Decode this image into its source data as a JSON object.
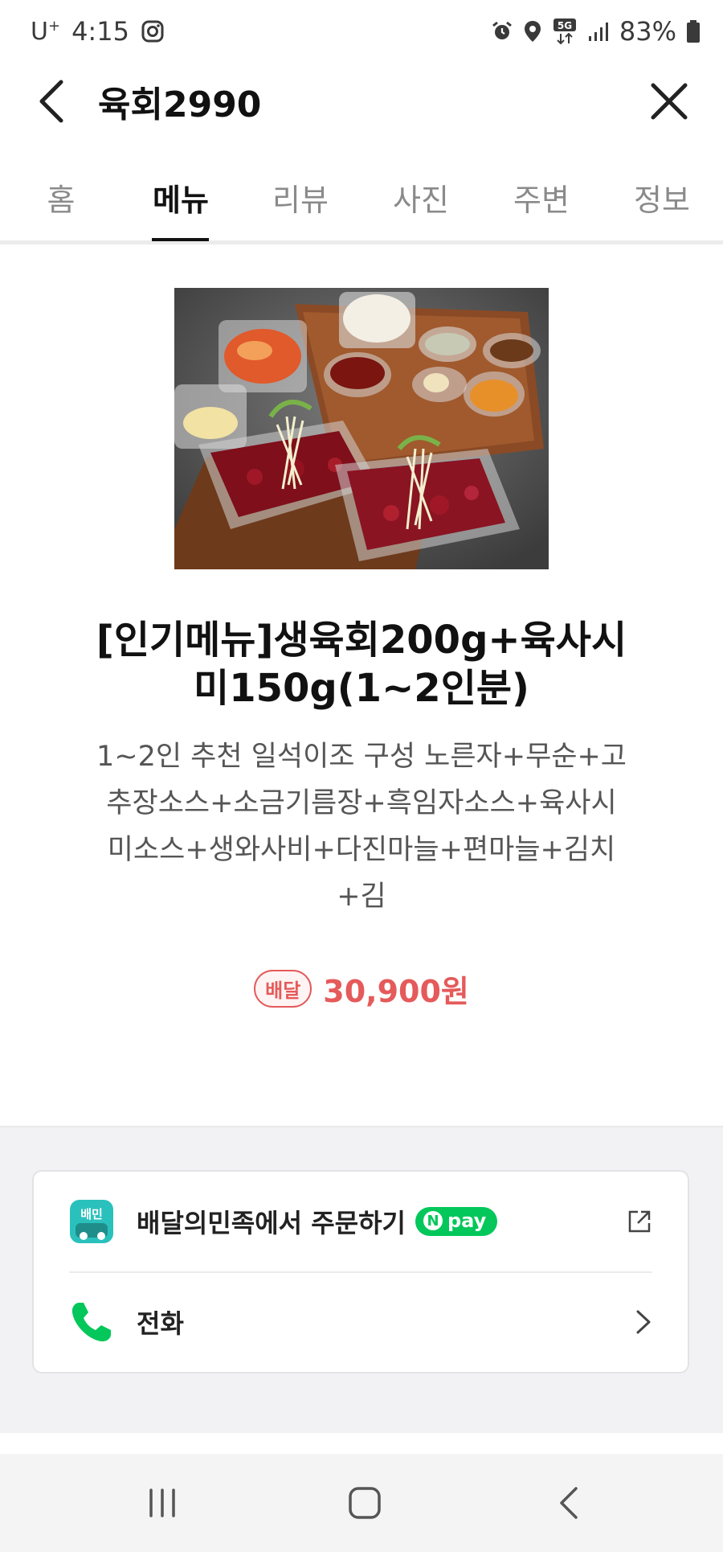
{
  "status_bar": {
    "carrier": "U",
    "carrier_sup": "+",
    "time": "4:15",
    "network": "5G",
    "battery": "83%"
  },
  "header": {
    "title": "육회2990"
  },
  "tabs": [
    {
      "label": "홈",
      "active": false
    },
    {
      "label": "메뉴",
      "active": true
    },
    {
      "label": "리뷰",
      "active": false
    },
    {
      "label": "사진",
      "active": false
    },
    {
      "label": "주변",
      "active": false
    },
    {
      "label": "정보",
      "active": false
    }
  ],
  "menu_item": {
    "name_line1": "[인기메뉴]생육회200g+육사시",
    "name_line2": "미150g(1~2인분)",
    "desc_line1": "1~2인 추천 일석이조 구성 노른자+무순+고",
    "desc_line2": "추장소스+소금기름장+흑임자소스+육사시",
    "desc_line3": "미소스+생와사비+다진마늘+편마늘+김치",
    "desc_line4": "+김",
    "badge": "배달",
    "price": "30,900원"
  },
  "actions": {
    "baemin_icon_text": "배민",
    "order_label": "배달의민족에서 주문하기",
    "npay_label": "pay",
    "npay_n": "N",
    "call_label": "전화"
  },
  "colors": {
    "accent_red": "#e55a5a",
    "npay_green": "#03c75a",
    "call_green": "#03c75a"
  }
}
